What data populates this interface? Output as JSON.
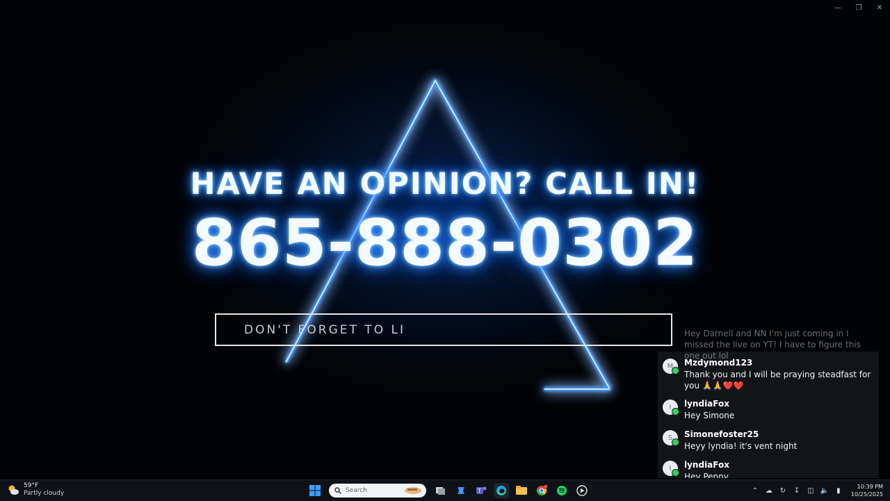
{
  "window": {
    "minimize_icon": "minimize-icon",
    "restore_icon": "restore-icon",
    "close_icon": "close-icon"
  },
  "stream": {
    "headline": "HAVE AN OPINION? CALL IN!",
    "phone": "865-888-0302",
    "ticker": "DON'T FORGET TO LI",
    "accent_color": "#2f8fff"
  },
  "chat": {
    "messages": [
      {
        "user": "",
        "avatar_letter": "",
        "text": "Hey Darnell and NN I'm just coming in I missed the live on YT! I have to figure this one out lol"
      },
      {
        "user": "Mzdymond123",
        "avatar_letter": "M",
        "text": "Thank you and I will be praying steadfast for you 🙏🙏❤️❤️"
      },
      {
        "user": "lyndiaFox",
        "avatar_letter": "I",
        "text": "Hey Simone"
      },
      {
        "user": "Simonefoster25",
        "avatar_letter": "S",
        "text": "Heyy lyndia! it's vent night"
      },
      {
        "user": "lyndiaFox",
        "avatar_letter": "I",
        "text": "Hey Penny"
      }
    ]
  },
  "taskbar": {
    "weather": {
      "temp": "59°F",
      "desc": "Partly cloudy",
      "icon": "partly-cloudy-icon"
    },
    "search_placeholder": "Search",
    "apps": [
      "start-icon",
      "search-icon",
      "task-view-icon",
      "copilot-icon",
      "teams-icon",
      "edge-icon",
      "file-explorer-icon",
      "chrome-icon",
      "spotify-icon",
      "media-player-icon"
    ],
    "tray": [
      "chevron-up-icon",
      "cloud-icon",
      "sync-icon",
      "download-icon",
      "network-icon",
      "volume-icon",
      "battery-icon"
    ],
    "time": "10:39 PM",
    "date": "10/25/2025"
  }
}
